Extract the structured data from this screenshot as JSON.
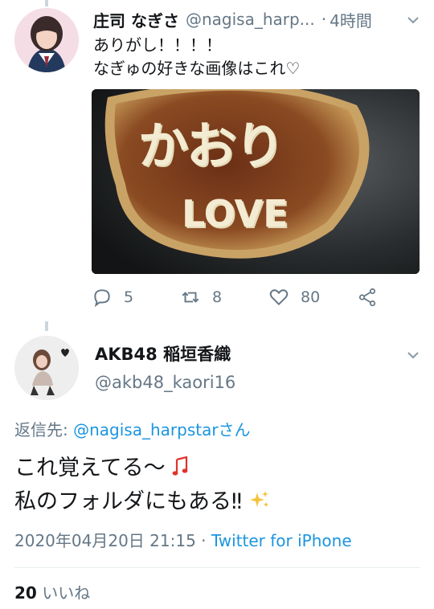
{
  "reply_tweet": {
    "display_name": "庄司 なぎさ",
    "handle": "@nagisa_harp...",
    "separator": "·",
    "time": "4時間",
    "text_line1": "ありがし！！！！",
    "text_line2": "なぎゅの好きな画像はこれ♡",
    "image_text_top": "かおり",
    "image_text_bottom": "LOVE",
    "actions": {
      "reply_count": "5",
      "retweet_count": "8",
      "like_count": "80"
    }
  },
  "main_tweet": {
    "display_name": "AKB48 稲垣香織",
    "handle": "@akb48_kaori16",
    "replying_to_label": "返信先: ",
    "replying_to_user": "@nagisa_harpstarさん",
    "text_line1": "これ覚えてる〜",
    "text_line2": "私のフォルダにもある‼",
    "timestamp": "2020年04月20日 21:15",
    "dot": " · ",
    "source": "Twitter for iPhone",
    "likes_count": "20",
    "likes_label": "いいね"
  },
  "colors": {
    "link": "#1b95e0",
    "muted": "#657786",
    "divider": "#e6ecf0"
  }
}
